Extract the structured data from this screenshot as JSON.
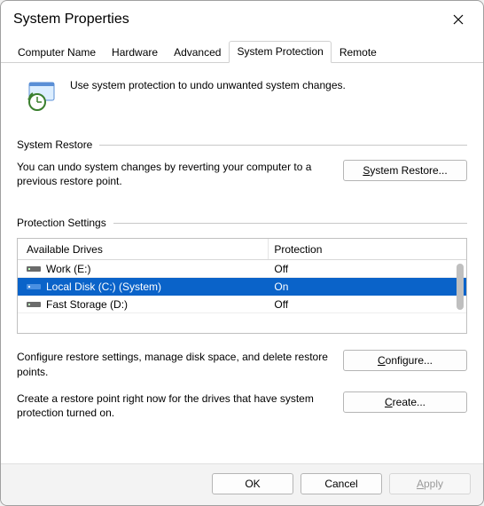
{
  "window": {
    "title": "System Properties"
  },
  "tabs": [
    "Computer Name",
    "Hardware",
    "Advanced",
    "System Protection",
    "Remote"
  ],
  "active_tab_index": 3,
  "intro": "Use system protection to undo unwanted system changes.",
  "sections": {
    "restore": {
      "title": "System Restore",
      "text": "You can undo system changes by reverting your computer to a previous restore point.",
      "button_full": "System Restore...",
      "button_prefix": "S",
      "button_rest": "ystem Restore..."
    },
    "protection": {
      "title": "Protection Settings",
      "headers": {
        "drives": "Available Drives",
        "protection": "Protection"
      },
      "drives": [
        {
          "name": "Work (E:)",
          "protection": "Off",
          "selected": false
        },
        {
          "name": "Local Disk (C:) (System)",
          "protection": "On",
          "selected": true
        },
        {
          "name": "Fast Storage (D:)",
          "protection": "Off",
          "selected": false
        }
      ],
      "configure": {
        "text": "Configure restore settings, manage disk space, and delete restore points.",
        "button_full": "Configure...",
        "button_prefix": "C",
        "button_rest": "onfigure..."
      },
      "create": {
        "text": "Create a restore point right now for the drives that have system protection turned on.",
        "button_full": "Create...",
        "button_prefix": "C",
        "button_rest": "reate..."
      }
    }
  },
  "footer": {
    "ok": "OK",
    "cancel": "Cancel",
    "apply_full": "Apply",
    "apply_prefix": "A",
    "apply_rest": "pply"
  }
}
